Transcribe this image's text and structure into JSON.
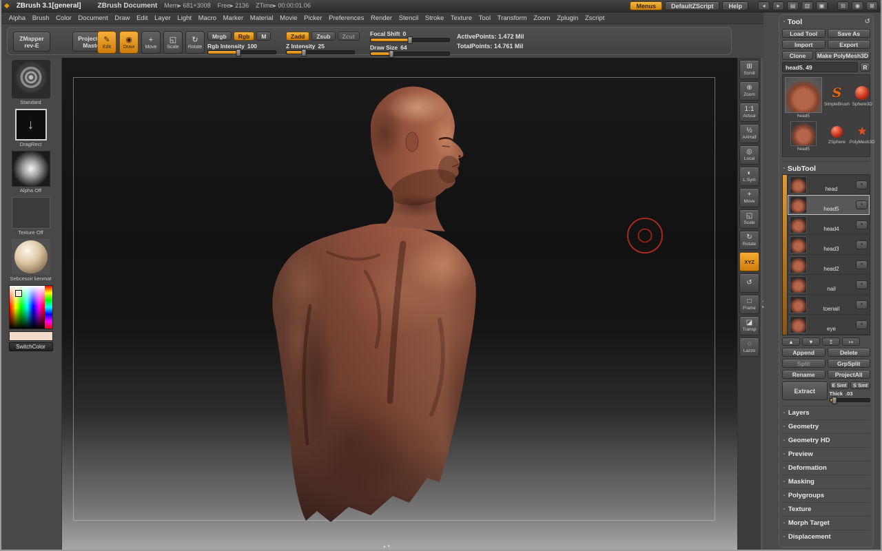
{
  "titlebar": {
    "app_title": "ZBrush 3.1[general]",
    "doc_title": "ZBrush Document",
    "mem": "Mem▸ 681+3008",
    "free": "Free▸ 2136",
    "ztime": "ZTime▸ 00:00:01.06",
    "menus_button": "Menus",
    "zscript_button": "DefaultZScript",
    "help_button": "Help"
  },
  "menubar": {
    "items": [
      "Alpha",
      "Brush",
      "Color",
      "Document",
      "Draw",
      "Edit",
      "Layer",
      "Light",
      "Macro",
      "Marker",
      "Material",
      "Movie",
      "Picker",
      "Preferences",
      "Render",
      "Stencil",
      "Stroke",
      "Texture",
      "Tool",
      "Transform",
      "Zoom",
      "Zplugin",
      "Zscript"
    ]
  },
  "toolbar": {
    "zmapper_line1": "ZMapper",
    "zmapper_line2": "rev-E",
    "projection_line1": "Projection",
    "projection_line2": "Master",
    "mode_buttons": [
      {
        "label": "Edit",
        "glyph": "✎",
        "active": true
      },
      {
        "label": "Draw",
        "glyph": "◉",
        "active": true
      },
      {
        "label": "Move",
        "glyph": "+",
        "active": false
      },
      {
        "label": "Scale",
        "glyph": "◱",
        "active": false
      },
      {
        "label": "Rotate",
        "glyph": "↻",
        "active": false
      }
    ],
    "color_modes": [
      {
        "label": "Mrgb"
      },
      {
        "label": "Rgb",
        "active": true
      },
      {
        "label": "M"
      }
    ],
    "rgb_intensity": {
      "label": "Rgb Intensity",
      "value": "100",
      "fill_pct": 45
    },
    "sculpt_modes": [
      {
        "label": "Zadd",
        "active": true
      },
      {
        "label": "Zsub"
      },
      {
        "label": "Zcut",
        "disabled": true
      }
    ],
    "z_intensity": {
      "label": "Z Intensity",
      "value": "25",
      "fill_pct": 25
    },
    "focal_shift": {
      "label": "Focal Shift",
      "value": "0",
      "fill_pct": 50
    },
    "draw_size": {
      "label": "Draw Size",
      "value": "64",
      "fill_pct": 26
    },
    "active_points": "ActivePoints: 1.472 Mil",
    "total_points": "TotalPoints: 14.761 Mil"
  },
  "left_shelf": {
    "brush_label": "Standard",
    "stroke_label": "DragRect",
    "alpha_label": "Alpha Off",
    "texture_label": "Texture Off",
    "material_label": "Sebcesoir kenmat",
    "switch_color_label": "SwitchColor",
    "current_color": "#f2dcc8"
  },
  "right_shelf": {
    "items": [
      {
        "label": "Scroll",
        "glyph": "⊞"
      },
      {
        "label": "Zoom",
        "glyph": "⊕"
      },
      {
        "label": "Actual",
        "glyph": "1:1"
      },
      {
        "label": "AAHalf",
        "glyph": "½"
      },
      {
        "label": "Local",
        "glyph": "◎"
      },
      {
        "label": "L.Sym",
        "glyph": "◐"
      },
      {
        "label": "Move",
        "glyph": "+"
      },
      {
        "label": "Scale",
        "glyph": "◱"
      },
      {
        "label": "Rotate",
        "glyph": "↻"
      },
      {
        "label": "XYZ",
        "glyph": "",
        "active": true
      },
      {
        "label": "",
        "glyph": "↺"
      },
      {
        "label": "Frame",
        "glyph": "□"
      },
      {
        "label": "Transp",
        "glyph": "◪"
      },
      {
        "label": "Lazzo",
        "glyph": "◌"
      }
    ]
  },
  "tool_panel": {
    "title": "Tool",
    "load_tool": "Load Tool",
    "save_as": "Save As",
    "import": "Import",
    "export": "Export",
    "clone": "Clone",
    "make_polymesh": "Make PolyMesh3D",
    "current_tool": "head5. 49",
    "r_button": "R",
    "inventory": {
      "active_thumb_label": "head5",
      "simplebrush": "SimpleBrush",
      "sphere3d": "Sphere3D",
      "zsphere": "ZSphere",
      "polymesh3d": "PolyMesh3D",
      "recent_thumb_label": "head5"
    },
    "subtool": {
      "title": "SubTool",
      "items": [
        {
          "name": "head"
        },
        {
          "name": "head5",
          "selected": true
        },
        {
          "name": "head4"
        },
        {
          "name": "head3"
        },
        {
          "name": "head2"
        },
        {
          "name": "nail"
        },
        {
          "name": "toenail"
        },
        {
          "name": "eye"
        }
      ],
      "action_buttons": [
        {
          "label": "Append"
        },
        {
          "label": "Delete"
        },
        {
          "label": "Split",
          "disabled": true
        },
        {
          "label": "GrpSplit"
        },
        {
          "label": "Rename"
        },
        {
          "label": "ProjectAll"
        }
      ],
      "extract_label": "Extract",
      "e_smt": "E Smt",
      "s_smt": "S Smt",
      "thick": {
        "label": "Thick",
        "value": ".03",
        "fill_pct": 12
      }
    },
    "palettes": [
      "Layers",
      "Geometry",
      "Geometry HD",
      "Preview",
      "Deformation",
      "Masking",
      "Polygroups",
      "Texture",
      "Morph Target",
      "Displacement"
    ]
  },
  "icons": {
    "logo": "◆",
    "tray_left": "◂",
    "tray_right": "▸",
    "panel_a": "▤",
    "panel_b": "▥",
    "lock": "▣",
    "win_a": "⊟",
    "win_b": "◉",
    "win_c": "⊠",
    "palette_curl": "◔",
    "refresh": "↺",
    "eye_dot": "●",
    "stroke_arrow": "↓",
    "subtool_up": "▲",
    "subtool_down": "▼",
    "subtool_up2": "↥",
    "subtool_out": "↦",
    "divider_left": "◂",
    "divider_right": "▸",
    "canvas_up": "▴",
    "canvas_down": "▾"
  }
}
